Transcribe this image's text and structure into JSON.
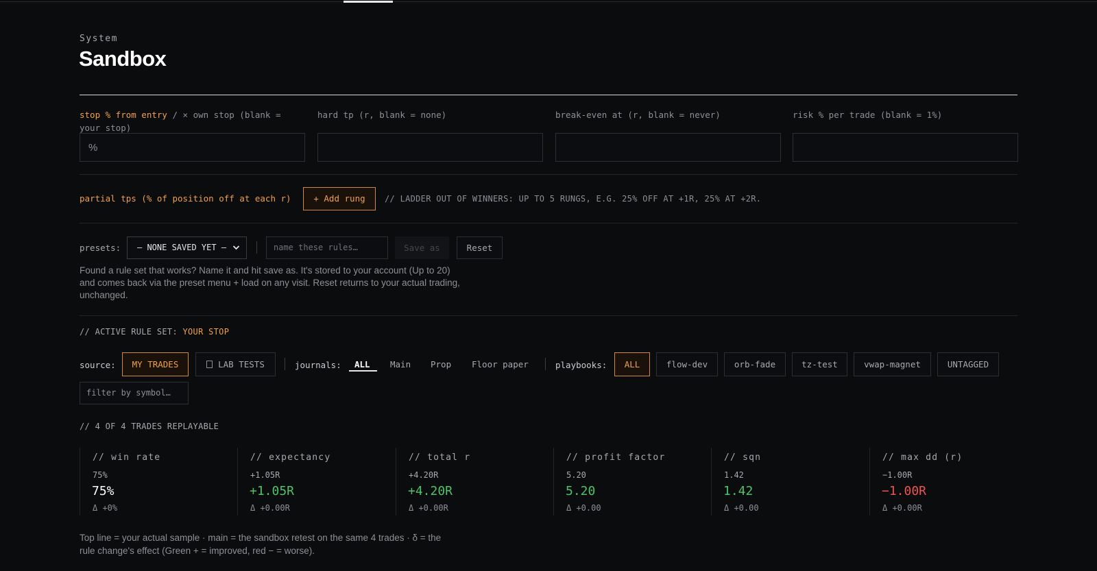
{
  "header": {
    "eyebrow": "System",
    "title": "Sandbox"
  },
  "fields": [
    {
      "label_highlight": "stop % from entry",
      "label_rest": " / × own stop (blank = your stop)",
      "placeholder": "%"
    },
    {
      "label_highlight": "",
      "label_rest": "hard tp (r, blank = none)",
      "placeholder": ""
    },
    {
      "label_highlight": "",
      "label_rest": "break-even at (r, blank = never)",
      "placeholder": ""
    },
    {
      "label_highlight": "",
      "label_rest": "risk % per trade (blank = 1%)",
      "placeholder": ""
    }
  ],
  "partial": {
    "label": "partial tps (% of position off at each r)",
    "add_button": "+ Add rung",
    "note": "// LADDER OUT OF WINNERS: UP TO 5 RUNGS, E.G. 25% OFF AT +1R, 25% AT +2R."
  },
  "presets": {
    "label": "presets:",
    "selected": "— NONE SAVED YET —",
    "name_placeholder": "name these rules…",
    "save_as": "Save as",
    "reset": "Reset",
    "note": "Found a rule set that works? Name it and hit save as. It's stored to your account (Up to 20) and comes back via the preset menu + load on any visit. Reset returns to your actual trading, unchanged."
  },
  "active_set": {
    "prefix": "// ACTIVE RULE SET: ",
    "value": "YOUR STOP"
  },
  "source": {
    "label": "source:",
    "options": [
      "MY TRADES",
      "LAB TESTS"
    ]
  },
  "journals": {
    "label": "journals:",
    "tabs": [
      "ALL",
      "Main",
      "Prop",
      "Floor paper"
    ]
  },
  "playbooks": {
    "label": "playbooks:",
    "chips": [
      "ALL",
      "flow-dev",
      "orb-fade",
      "tz-test",
      "vwap-magnet",
      "UNTAGGED"
    ]
  },
  "symbol_filter": {
    "placeholder": "filter by symbol…"
  },
  "replayable": "// 4 OF 4 TRADES REPLAYABLE",
  "stats": [
    {
      "label": "// win rate",
      "top": "75%",
      "main": "75%",
      "delta": "Δ +0%"
    },
    {
      "label": "// expectancy",
      "top": "+1.05R",
      "main": "+1.05R",
      "delta": "Δ +0.00R"
    },
    {
      "label": "// total r",
      "top": "+4.20R",
      "main": "+4.20R",
      "delta": "Δ +0.00R"
    },
    {
      "label": "// profit factor",
      "top": "5.20",
      "main": "5.20",
      "delta": "Δ +0.00"
    },
    {
      "label": "// sqn",
      "top": "1.42",
      "main": "1.42",
      "delta": "Δ +0.00"
    },
    {
      "label": "// max dd (r)",
      "top": "−1.00R",
      "main": "−1.00R",
      "delta": "Δ +0.00R"
    }
  ],
  "colors": {
    "accent": "#f0a04b",
    "positive": "#4fc36a",
    "negative": "#ef5350",
    "neutral": "#ffffff"
  },
  "footnote": "Top line = your actual sample · main = the sandbox retest on the same 4 trades · δ = the rule change's effect (Green + = improved, red − = worse)."
}
